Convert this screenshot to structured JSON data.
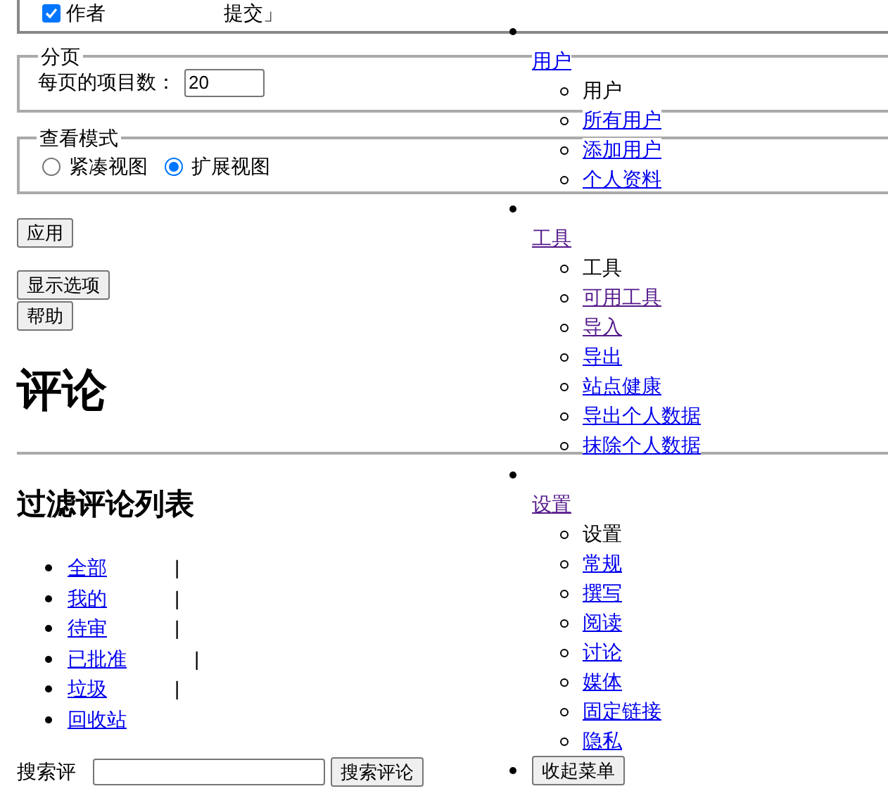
{
  "filter_option": {
    "checked": true,
    "label": "作者",
    "suffix": "提交」"
  },
  "pagination": {
    "legend": "分页",
    "label": "每页的项目数：",
    "value": "20"
  },
  "view_mode": {
    "legend": "查看模式",
    "options": [
      {
        "label": "紧凑视图",
        "selected": false
      },
      {
        "label": "扩展视图",
        "selected": true
      }
    ]
  },
  "buttons": [
    "应用",
    "显示选项",
    "帮助"
  ],
  "heading": "评论",
  "subheading": "过滤评论列表",
  "filters": [
    {
      "label": "全部",
      "separator": "|"
    },
    {
      "label": "我的",
      "separator": "|"
    },
    {
      "label": "待审",
      "separator": "|"
    },
    {
      "label": "已批准",
      "separator": "|"
    },
    {
      "label": "垃圾",
      "separator": "|"
    },
    {
      "label": "回收站"
    }
  ],
  "search": {
    "label": "搜索评",
    "button": "搜索评论"
  },
  "admin_menu": {
    "groups": [
      {
        "label": "用户",
        "visited": false,
        "children": [
          {
            "label": "用户",
            "current": true
          },
          {
            "label": "所有用户",
            "current": false,
            "visited": false
          },
          {
            "label": "添加用户",
            "current": false,
            "visited": false
          },
          {
            "label": "个人资料",
            "current": false,
            "visited": false
          }
        ]
      },
      {
        "label": "工具",
        "visited": true,
        "children": [
          {
            "label": "工具",
            "current": true
          },
          {
            "label": "可用工具",
            "current": false,
            "visited": true
          },
          {
            "label": "导入",
            "current": false,
            "visited": true
          },
          {
            "label": "导出",
            "current": false,
            "visited": false
          },
          {
            "label": "站点健康",
            "current": false,
            "visited": false
          },
          {
            "label": "导出个人数据",
            "current": false,
            "visited": false
          },
          {
            "label": "抹除个人数据",
            "current": false,
            "visited": false
          }
        ]
      },
      {
        "label": "设置",
        "visited": true,
        "children": [
          {
            "label": "设置",
            "current": true
          },
          {
            "label": "常规",
            "current": false,
            "visited": false
          },
          {
            "label": "撰写",
            "current": false,
            "visited": false
          },
          {
            "label": "阅读",
            "current": false,
            "visited": false
          },
          {
            "label": "讨论",
            "current": false,
            "visited": false
          },
          {
            "label": "媒体",
            "current": false,
            "visited": false
          },
          {
            "label": "固定链接",
            "current": false,
            "visited": false
          },
          {
            "label": "隐私",
            "current": false,
            "visited": false
          }
        ]
      }
    ],
    "collapse_button": "收起菜单"
  }
}
